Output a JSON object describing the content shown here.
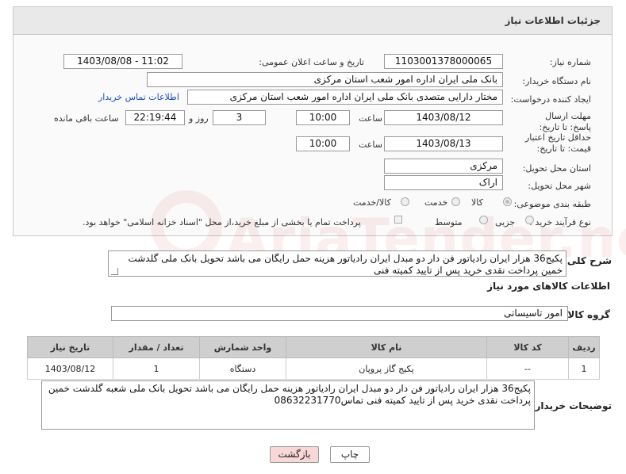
{
  "header": {
    "title": "جزئیات اطلاعات نیاز"
  },
  "form": {
    "need_number_label": "شماره نیاز:",
    "need_number": "1103001378000065",
    "announce_label": "تاریخ و ساعت اعلان عمومی:",
    "announce_value": "1403/08/08 - 11:02",
    "buyer_label": "نام دستگاه خریدار:",
    "buyer_value": "بانک ملی ایران اداره امور شعب استان مرکزی",
    "creator_label": "ایجاد کننده درخواست:",
    "creator_value": "مختار دارایی  متصدی  بانک ملی ایران اداره امور شعب استان مرکزی",
    "contact_link": "اطلاعات تماس خریدار",
    "reply_label": "مهلت ارسال پاسخ: تا تاریخ:",
    "reply_date": "1403/08/12",
    "time_label": "ساعت",
    "reply_time": "10:00",
    "days_value": "3",
    "days_label": "روز و",
    "remaining_value": "22:19:44",
    "remaining_label": "ساعت باقی مانده",
    "price_label": "حداقل تاریخ اعتبار قیمت: تا تاریخ:",
    "price_date": "1403/08/13",
    "price_time_label": "ساعت",
    "price_time": "10:00",
    "province_label": "استان محل تحویل:",
    "province_value": "مرکزی",
    "city_label": "شهر محل تحویل:",
    "city_value": "اراک",
    "category_label": "طبقه بندی موضوعی:",
    "category_options": [
      "کالا",
      "خدمت",
      "کالا/خدمت"
    ],
    "category_selected": "کالا",
    "process_label": "نوع فرآیند خرید :",
    "process_options": [
      "جزیی",
      "متوسط"
    ],
    "process_note": "پرداخت تمام یا بخشی از مبلغ خرید،از محل \"اسناد خزانه اسلامی\" خواهد بود."
  },
  "description": {
    "label": "شرح کلی نیاز:",
    "text": "پکیج36 هزار ایران رادیاتور فن دار دو مبدل ایران رادیاتور هزینه حمل رایگان می باشد تحویل بانک ملی گلدشت خمین پرداخت نقدی خرید پس از تایید کمیته فنی"
  },
  "goods": {
    "section_title": "اطلاعات کالاهای مورد نیاز",
    "group_label": "گروه کالا:",
    "group_value": "امور تاسیساتی",
    "columns": [
      "ردیف",
      "کد کالا",
      "نام کالا",
      "واحد شمارش",
      "تعداد / مقدار",
      "تاریخ نیاز"
    ],
    "rows": [
      [
        "1",
        "--",
        "پکیج گاز پروپان",
        "دستگاه",
        "1",
        "1403/08/12"
      ]
    ]
  },
  "buyer_notes": {
    "label": "توضیحات خریدار:",
    "text": "پکیج36 هزار ایران رادیاتور فن دار دو مبدل ایران رادیاتور هزینه حمل رایگان می باشد تحویل بانک ملی شعبه گلدشت خمین پرداخت نقدی خرید پس از تایید کمیته فنی  تماس08632231770"
  },
  "buttons": {
    "print": "چاپ",
    "back": "بازگشت"
  },
  "watermark": {
    "text": "AriaTender.neT"
  },
  "colors": {
    "link": "#1a4fb5",
    "back_button": "#f8d7d7",
    "header_bg": "#e9e9e9",
    "table_header": "#cfcfcf"
  }
}
